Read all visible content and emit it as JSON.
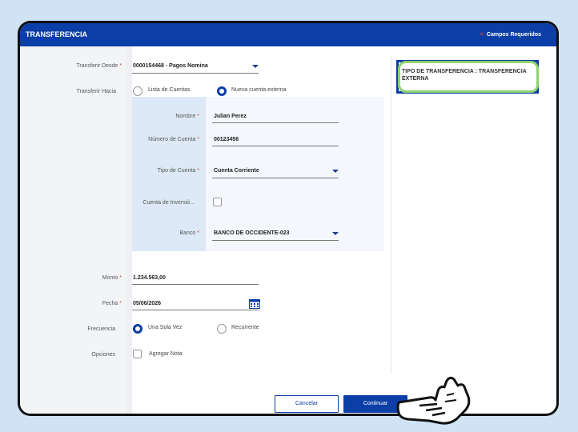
{
  "header": {
    "title": "TRANSFERENCIA",
    "required_note": "Campos Requeridos"
  },
  "form": {
    "from": {
      "label": "Transferir Desde",
      "value": "0000154468 - Pagos Nomina"
    },
    "to": {
      "label": "Transferir Hacia",
      "option_list": "Lista de Cuentas",
      "option_new": "Nueva cuenta externa",
      "selected": "Nueva cuenta externa"
    },
    "external": {
      "name": {
        "label": "Nombre",
        "value": "Julian Perez"
      },
      "account_number": {
        "label": "Número de Cuenta",
        "value": "00123456"
      },
      "account_type": {
        "label": "Tipo de Cuenta",
        "value": "Cuenta Corriente"
      },
      "investment_account": {
        "label": "Cuenta de Inversió...",
        "checked": false
      },
      "bank": {
        "label": "Banco",
        "value": "BANCO DE OCCIDENTE-023"
      }
    },
    "amount": {
      "label": "Monto",
      "value": "1.234.563,00"
    },
    "date": {
      "label": "Fecha",
      "value": "05/06/2026"
    },
    "frequency": {
      "label": "Frecuencia",
      "option_once": "Una Sola Vez",
      "option_recurring": "Recurrente",
      "selected": "Una Sola Vez"
    },
    "options": {
      "label": "Opciones",
      "add_note": "Agregar Nota",
      "checked": false
    }
  },
  "info": {
    "text": "TIPO DE TRANSFERENCIA : TRANSFERENCIA EXTERNA"
  },
  "buttons": {
    "cancel": "Cancelar",
    "continue": "Continuar"
  },
  "colors": {
    "primary": "#0b3ea6",
    "required": "#e0443a",
    "highlight": "#8fd36f"
  }
}
